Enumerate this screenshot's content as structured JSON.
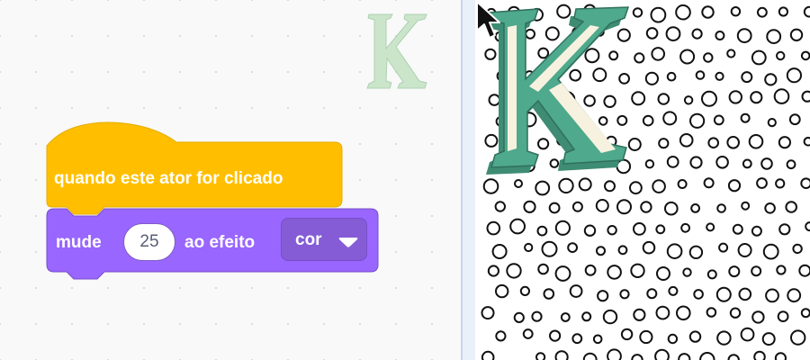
{
  "code_area": {
    "hat_block": {
      "label": "quando este ator for clicado",
      "color": "#FFBF00"
    },
    "looks_block": {
      "label_change": "mude",
      "amount": "25",
      "label_effect": "ao efeito",
      "effect_selected": "cor",
      "color": "#9966FF"
    },
    "sprite_watermark_icon": "letter-k-sprite-icon"
  },
  "stage": {
    "backdrop": "polka-dot-circles",
    "sprite": {
      "name_icon": "letter-k-sprite",
      "primary_color": "#4FA98C",
      "highlight_color": "#F6F2DF"
    },
    "cursor_icon": "arrow-cursor-icon"
  }
}
